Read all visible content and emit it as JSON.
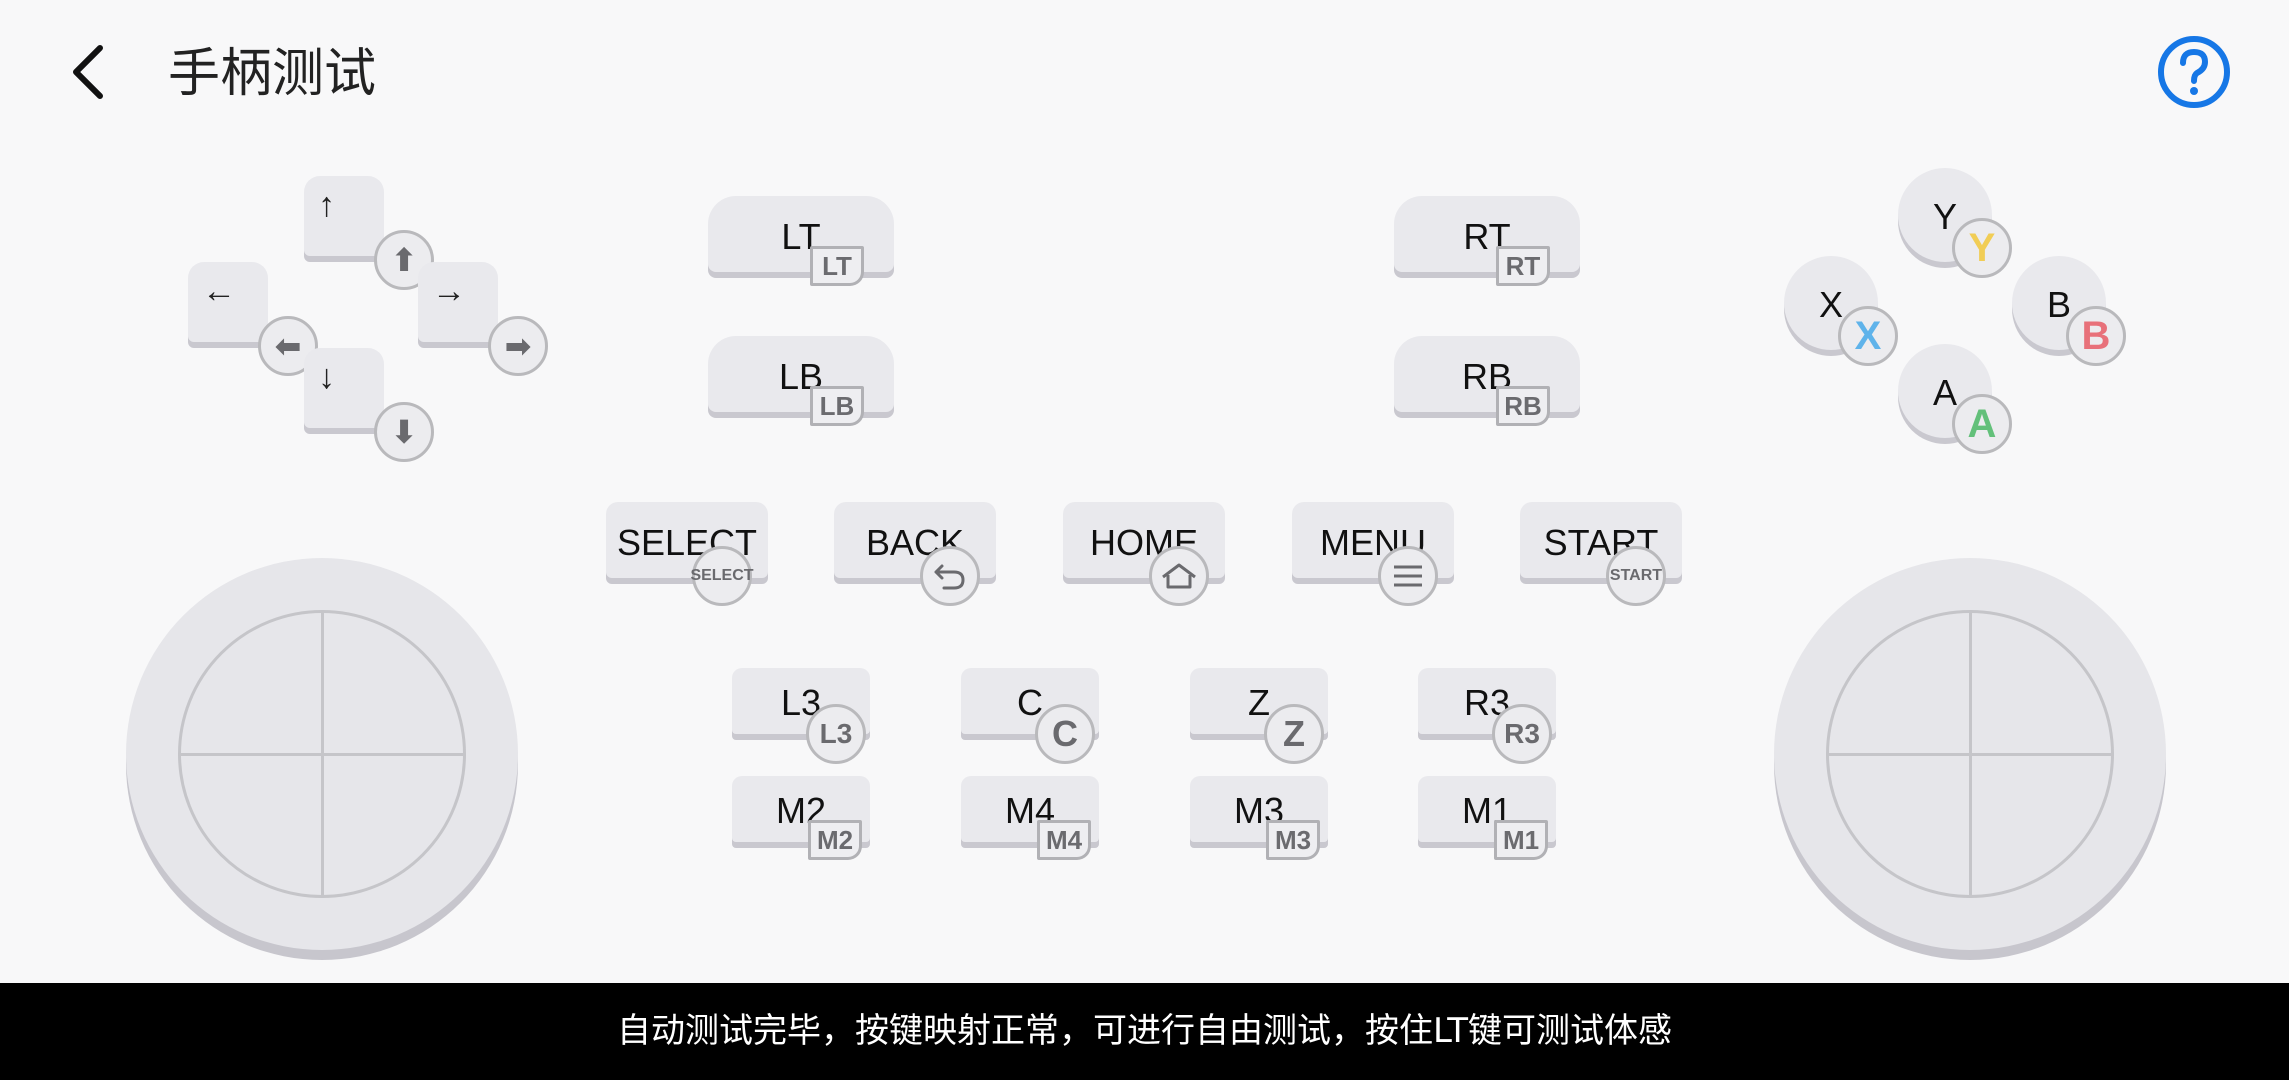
{
  "header": {
    "title": "手柄测试"
  },
  "colors": {
    "help": "#1677e6",
    "y_badge": "#f1cd55",
    "x_badge": "#5fb3ea",
    "b_badge": "#e8717a",
    "a_badge": "#63c07a"
  },
  "triggers": {
    "lt": {
      "label": "LT",
      "badge": "LT"
    },
    "lb": {
      "label": "LB",
      "badge": "LB"
    },
    "rt": {
      "label": "RT",
      "badge": "RT"
    },
    "rb": {
      "label": "RB",
      "badge": "RB"
    }
  },
  "face_buttons": {
    "y": {
      "label": "Y",
      "badge": "Y"
    },
    "x": {
      "label": "X",
      "badge": "X"
    },
    "b": {
      "label": "B",
      "badge": "B"
    },
    "a": {
      "label": "A",
      "badge": "A"
    }
  },
  "menu_keys": {
    "select": {
      "label": "SELECT",
      "badge": "SELECT"
    },
    "back": {
      "label": "BACK"
    },
    "home": {
      "label": "HOME"
    },
    "menu": {
      "label": "MENU"
    },
    "start": {
      "label": "START",
      "badge": "START"
    }
  },
  "small_keys": {
    "l3": {
      "label": "L3",
      "badge": "L3"
    },
    "c": {
      "label": "C",
      "badge": "C"
    },
    "z": {
      "label": "Z",
      "badge": "Z"
    },
    "r3": {
      "label": "R3",
      "badge": "R3"
    },
    "m2": {
      "label": "M2",
      "badge": "M2"
    },
    "m4": {
      "label": "M4",
      "badge": "M4"
    },
    "m3": {
      "label": "M3",
      "badge": "M3"
    },
    "m1": {
      "label": "M1",
      "badge": "M1"
    }
  },
  "status": {
    "message": "自动测试完毕，按键映射正常，可进行自由测试，按住LT键可测试体感"
  }
}
